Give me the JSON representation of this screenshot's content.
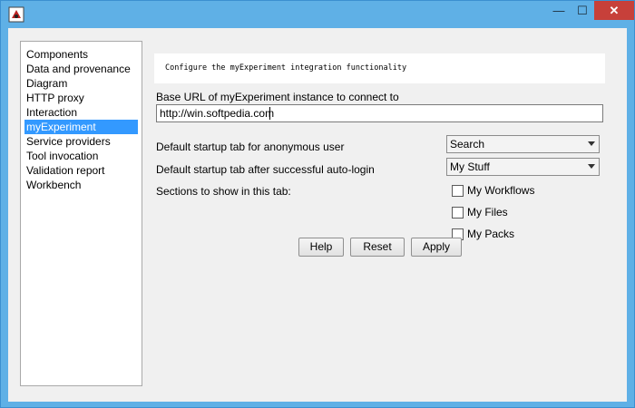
{
  "colors": {
    "titlebar": "#5fb0e6",
    "close": "#c7403a",
    "selection": "#3399ff"
  },
  "window": {
    "minimize": "—",
    "maximize": "☐",
    "close": "✕"
  },
  "nav": {
    "items": [
      {
        "label": "Components",
        "selected": false
      },
      {
        "label": "Data and provenance",
        "selected": false
      },
      {
        "label": "Diagram",
        "selected": false
      },
      {
        "label": "HTTP proxy",
        "selected": false
      },
      {
        "label": "Interaction",
        "selected": false
      },
      {
        "label": "myExperiment",
        "selected": true
      },
      {
        "label": "Service providers",
        "selected": false
      },
      {
        "label": "Tool invocation",
        "selected": false
      },
      {
        "label": "Validation report",
        "selected": false
      },
      {
        "label": "Workbench",
        "selected": false
      }
    ]
  },
  "panel": {
    "description": "Configure the myExperiment integration functionality",
    "base_url_label": "Base URL of myExperiment instance to connect to",
    "base_url_value": "http://win.softpedia.com",
    "anon_tab_label": "Default startup tab for anonymous user",
    "anon_tab_value": "Search",
    "login_tab_label": "Default startup tab after successful auto-login",
    "login_tab_value": "My Stuff",
    "sections_label": "Sections to show in this tab:",
    "sections": [
      {
        "label": "My Workflows",
        "checked": false
      },
      {
        "label": "My Files",
        "checked": false
      },
      {
        "label": "My Packs",
        "checked": false
      }
    ],
    "buttons": {
      "help": "Help",
      "reset": "Reset",
      "apply": "Apply"
    }
  }
}
